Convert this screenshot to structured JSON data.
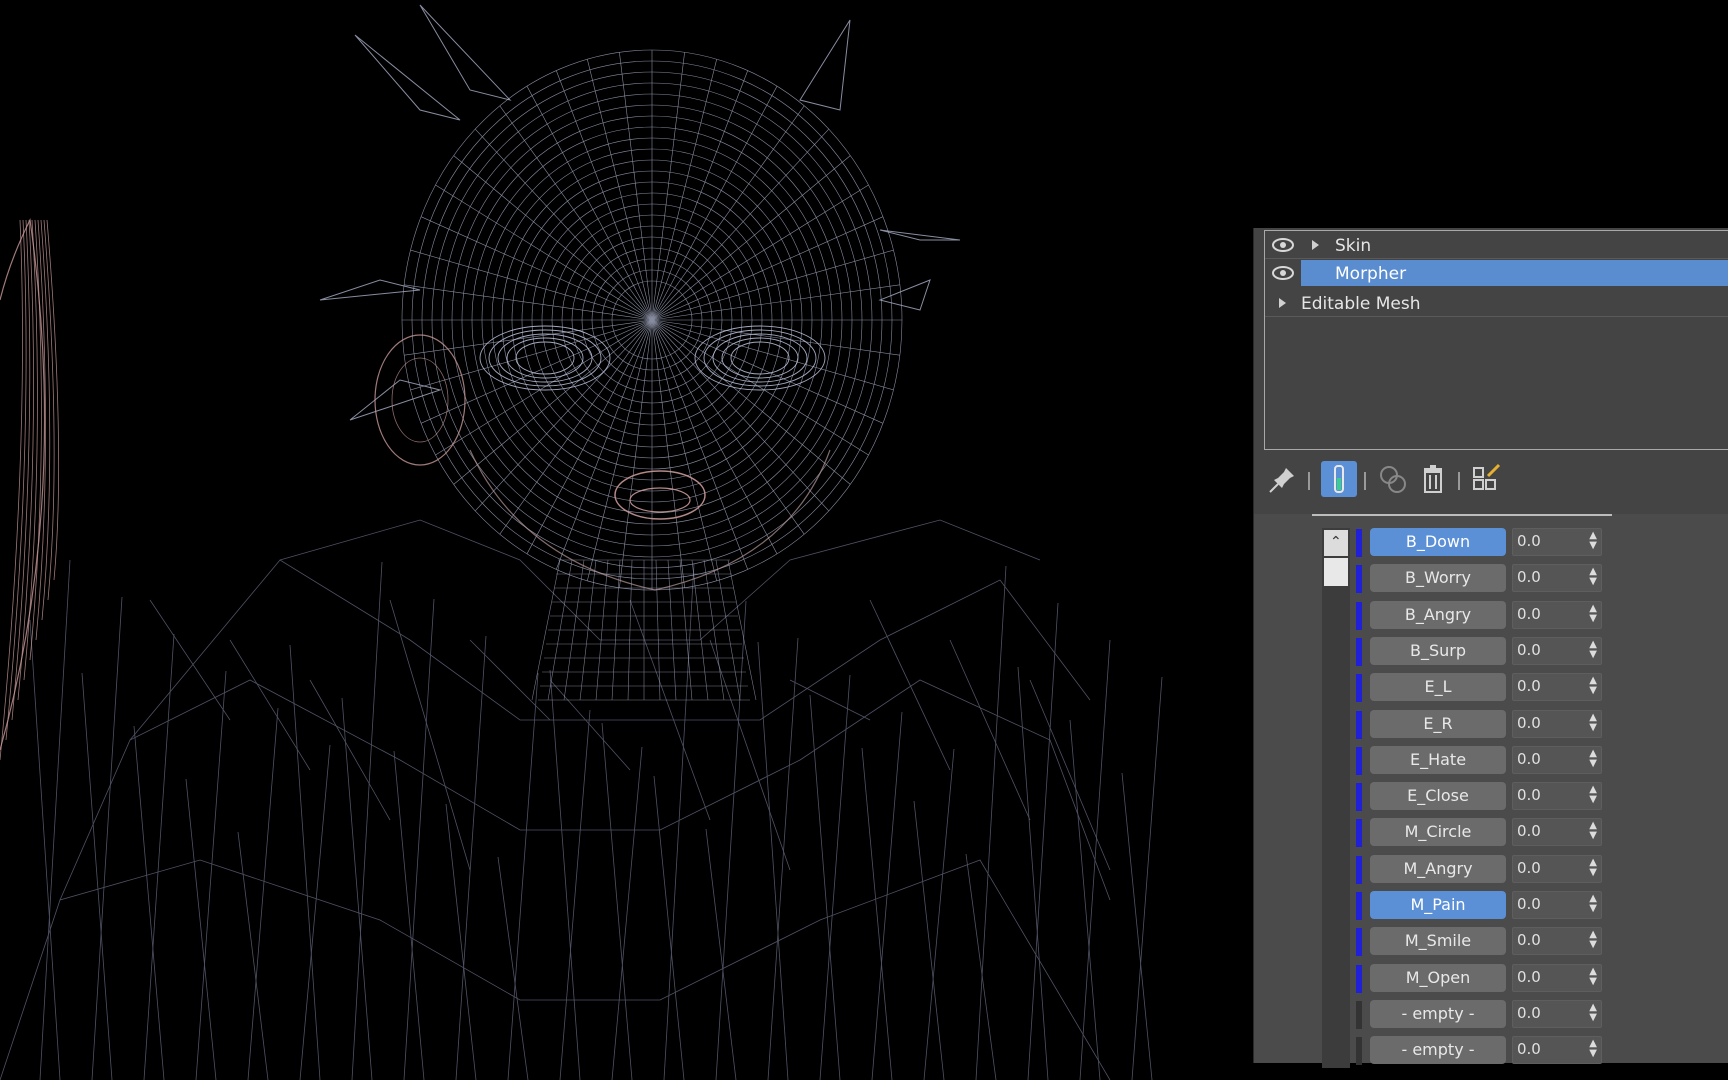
{
  "modifier_stack": {
    "items": [
      {
        "label": "Skin",
        "has_eye": true,
        "expandable": true,
        "selected": false
      },
      {
        "label": "Morpher",
        "has_eye": true,
        "expandable": false,
        "selected": true
      },
      {
        "label": "Editable Mesh",
        "has_eye": false,
        "expandable": true,
        "selected": false
      }
    ]
  },
  "toolbar": {
    "buttons": [
      "pin-stack-icon",
      "show-end-result-icon",
      "make-unique-icon",
      "remove-modifier-icon",
      "configure-modifier-sets-icon"
    ],
    "active": "show-end-result-icon"
  },
  "channels": [
    {
      "name": "B_Down",
      "value": "0.0",
      "active": true,
      "marker_color": "#2020d8"
    },
    {
      "name": "B_Worry",
      "value": "0.0",
      "active": false,
      "marker_color": "#2020d8"
    },
    {
      "name": "B_Angry",
      "value": "0.0",
      "active": false,
      "marker_color": "#2020d8"
    },
    {
      "name": "B_Surp",
      "value": "0.0",
      "active": false,
      "marker_color": "#2020d8"
    },
    {
      "name": "E_L",
      "value": "0.0",
      "active": false,
      "marker_color": "#2020d8"
    },
    {
      "name": "E_R",
      "value": "0.0",
      "active": false,
      "marker_color": "#2020d8"
    },
    {
      "name": "E_Hate",
      "value": "0.0",
      "active": false,
      "marker_color": "#2020d8"
    },
    {
      "name": "E_Close",
      "value": "0.0",
      "active": false,
      "marker_color": "#2020d8"
    },
    {
      "name": "M_Circle",
      "value": "0.0",
      "active": false,
      "marker_color": "#2020d8"
    },
    {
      "name": "M_Angry",
      "value": "0.0",
      "active": false,
      "marker_color": "#2020d8"
    },
    {
      "name": "M_Pain",
      "value": "0.0",
      "active": true,
      "marker_color": "#2020d8"
    },
    {
      "name": "M_Smile",
      "value": "0.0",
      "active": false,
      "marker_color": "#2020d8"
    },
    {
      "name": "M_Open",
      "value": "0.0",
      "active": false,
      "marker_color": "#2020d8"
    },
    {
      "name": "- empty -",
      "value": "0.0",
      "active": false,
      "marker_color": "#333333"
    },
    {
      "name": "- empty -",
      "value": "0.0",
      "active": false,
      "marker_color": "#333333"
    }
  ],
  "colors": {
    "viewport_bg": "#000000",
    "wire_main": "#aab0c8",
    "wire_skin": "#c89898",
    "wire_body": "#6a6e86",
    "selection": "#5a8dd0"
  }
}
